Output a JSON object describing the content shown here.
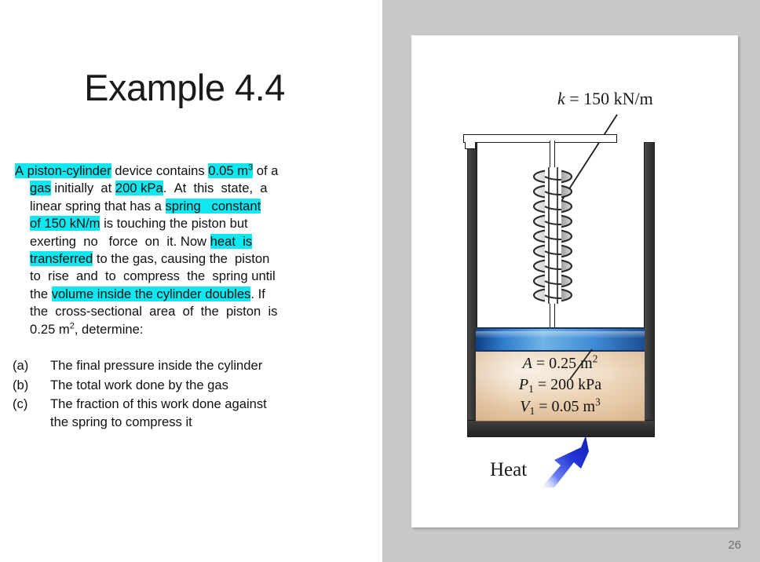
{
  "slide": {
    "title": "Example 4.4",
    "page_number": "26"
  },
  "problem": {
    "lines": [
      {
        "segments": [
          {
            "text": "A piston-cylinder",
            "highlight": true
          },
          {
            "text": " device contains ",
            "highlight": false
          },
          {
            "text": "0.05 m3",
            "highlight": true
          },
          {
            "text": " of a",
            "highlight": false
          }
        ]
      },
      {
        "segments": [
          {
            "text": "gas",
            "highlight": true
          },
          {
            "text": " initially at ",
            "highlight": false
          },
          {
            "text": "200 kPa",
            "highlight": true
          },
          {
            "text": ". At this state, a",
            "highlight": false
          }
        ]
      },
      {
        "segments": [
          {
            "text": "linear spring that has a ",
            "highlight": false
          },
          {
            "text": "spring   constant",
            "highlight": true
          }
        ]
      },
      {
        "segments": [
          {
            "text": "of 150 kN/m",
            "highlight": true
          },
          {
            "text": " is touching the piston but",
            "highlight": false
          }
        ]
      },
      {
        "segments": [
          {
            "text": "exerting no   force on it. Now ",
            "highlight": false
          },
          {
            "text": "heat  is",
            "highlight": true
          }
        ]
      },
      {
        "segments": [
          {
            "text": "transferred",
            "highlight": true
          },
          {
            "text": " to the gas, causing the  piston",
            "highlight": false
          }
        ]
      },
      {
        "segments": [
          {
            "text": "to rise and to compress the spring until",
            "highlight": false
          }
        ]
      },
      {
        "segments": [
          {
            "text": "the ",
            "highlight": false
          },
          {
            "text": "volume inside the cylinder doubles",
            "highlight": true
          },
          {
            "text": ". If",
            "highlight": false
          }
        ]
      },
      {
        "segments": [
          {
            "text": "the cross-sectional area of  the piston is",
            "highlight": false
          }
        ]
      },
      {
        "segments": [
          {
            "text": "0.25 m2, determine:",
            "highlight": false
          }
        ]
      }
    ],
    "full_text": "A piston-cylinder device contains 0.05 m3 of a gas initially at 200 kPa. At this state, a linear spring that has a spring constant of 150 kN/m is touching the piston but exerting no force on it. Now heat is transferred to the gas, causing the piston to rise and to compress the spring until the volume inside the cylinder doubles. If the cross-sectional area of the piston is 0.25 m2, determine:"
  },
  "questions": [
    {
      "marker": "(a)",
      "text": "The final pressure inside the cylinder",
      "text2": ""
    },
    {
      "marker": "(b)",
      "text": "The total work done by the gas",
      "text2": ""
    },
    {
      "marker": "(c)",
      "text": "The fraction of this work done against",
      "text2": "the spring to compress it"
    }
  ],
  "figure": {
    "spring_constant_label": "k = 150 kN/m",
    "spring_constant_symbol": "k",
    "spring_constant_value": "= 150 kN/m",
    "area_symbol": "A",
    "area_value": "= 0.25 m",
    "area_exponent": "2",
    "pressure_symbol": "P",
    "pressure_subscript": "1",
    "pressure_value": "= 200 kPa",
    "volume_symbol": "V",
    "volume_subscript": "1",
    "volume_value": "= 0.05 m",
    "volume_exponent": "3",
    "heat_label": "Heat"
  },
  "colors": {
    "highlight": "#0FE8F0",
    "panel_background": "#c8c8c8",
    "card_background": "#ffffff",
    "piston_blue": "#2f7ccd",
    "gas_tan": "#eacfae",
    "wall_dark": "#333333",
    "heat_arrow_blue": "#1f2fd8",
    "page_number_gray": "#6e6e6e"
  }
}
